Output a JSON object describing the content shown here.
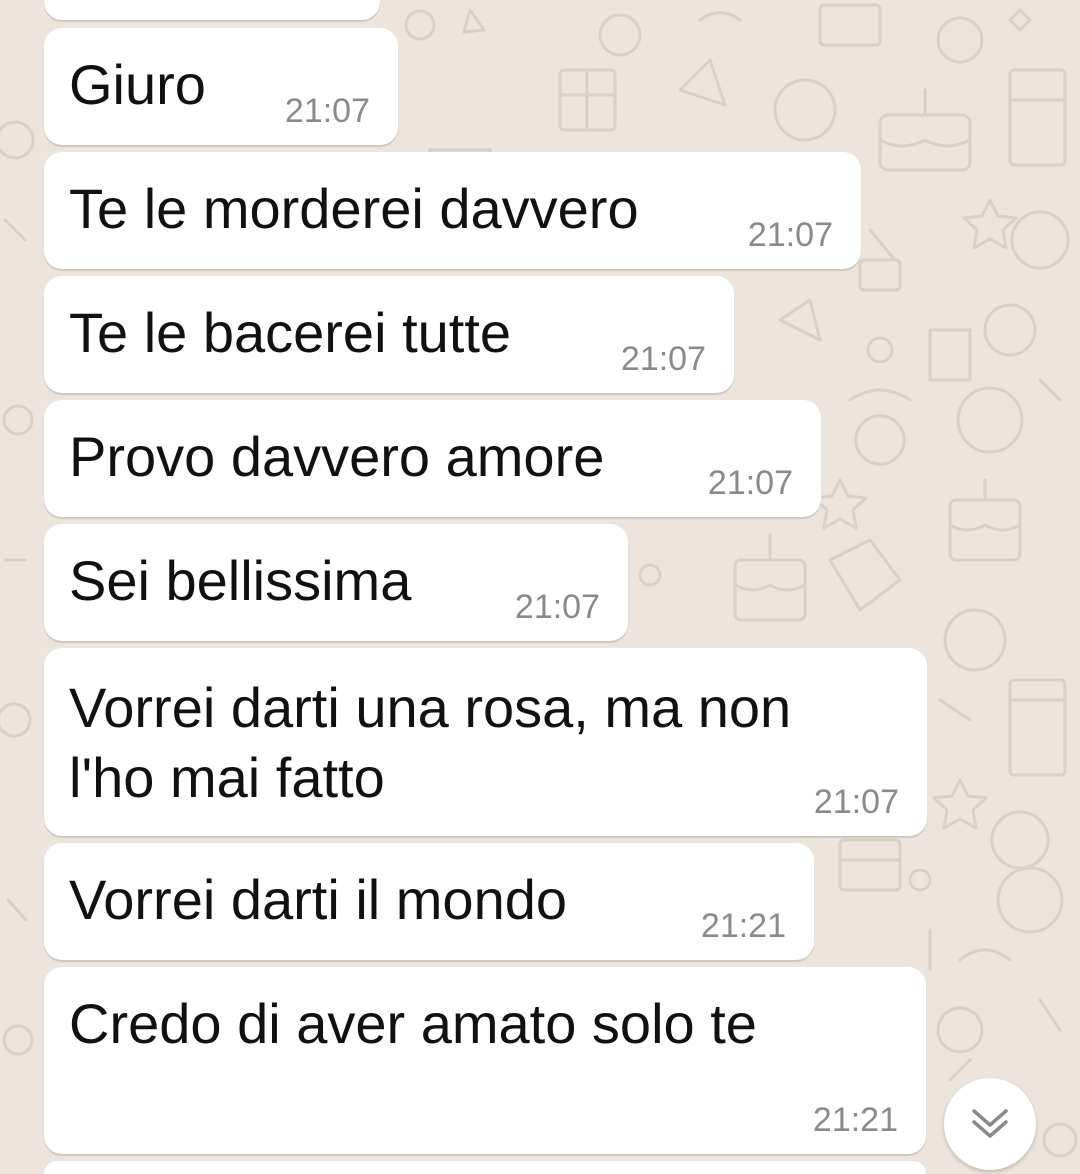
{
  "messages": [
    {
      "text": "",
      "time": ""
    },
    {
      "text": "Giuro",
      "time": "21:07"
    },
    {
      "text": "Te le morderei davvero",
      "time": "21:07"
    },
    {
      "text": "Te le bacerei tutte",
      "time": "21:07"
    },
    {
      "text": "Provo davvero amore",
      "time": "21:07"
    },
    {
      "text": "Sei bellissima",
      "time": "21:07"
    },
    {
      "text": "Vorrei darti una rosa, ma non l'ho mai fatto",
      "line1": "Vorrei darti una rosa, ma non",
      "line2": "l'ho mai fatto",
      "time": "21:07"
    },
    {
      "text": "Vorrei darti il mondo",
      "time": "21:21"
    },
    {
      "text": "Credo di aver amato solo te",
      "time": "21:21"
    },
    {
      "text": "",
      "time": ""
    }
  ],
  "scroll_button": {
    "icon": "double-chevron-down-icon"
  },
  "colors": {
    "wallpaper": "#ece5dd",
    "bubble": "#ffffff",
    "time": "#8a8a8a",
    "text": "#111111"
  }
}
